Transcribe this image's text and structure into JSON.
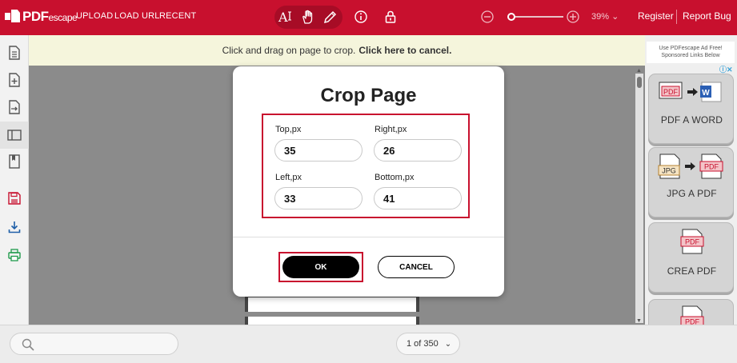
{
  "topbar": {
    "logo_main": "PDF",
    "logo_sub": "escape",
    "nav": [
      "UPLOAD",
      "LOAD URL",
      "RECENT"
    ],
    "zoom_level": "39%",
    "zoom_fraction": 0.05,
    "register": "Register",
    "report_bug": "Report Bug",
    "colors": {
      "brand": "#c8102e"
    }
  },
  "message": {
    "text": "Click and drag on page to crop.",
    "cancel_link": "Click here to cancel."
  },
  "modal": {
    "title": "Crop Page",
    "fields": {
      "top": {
        "label": "Top,px",
        "value": "35"
      },
      "right": {
        "label": "Right,px",
        "value": "26"
      },
      "left": {
        "label": "Left,px",
        "value": "33"
      },
      "bottom": {
        "label": "Bottom,px",
        "value": "41"
      }
    },
    "ok_label": "OK",
    "cancel_label": "CANCEL"
  },
  "ads": {
    "note_line1": "Use PDFescape Ad Free!",
    "note_line2": "Sponsored Links Below",
    "cards": [
      {
        "label": "PDF A WORD"
      },
      {
        "label": "JPG A PDF"
      },
      {
        "label": "CREA PDF"
      }
    ],
    "badge_pdf": "PDF",
    "badge_jpg": "JPG",
    "badge_word": "W"
  },
  "bottom": {
    "pager": "1 of 350"
  }
}
